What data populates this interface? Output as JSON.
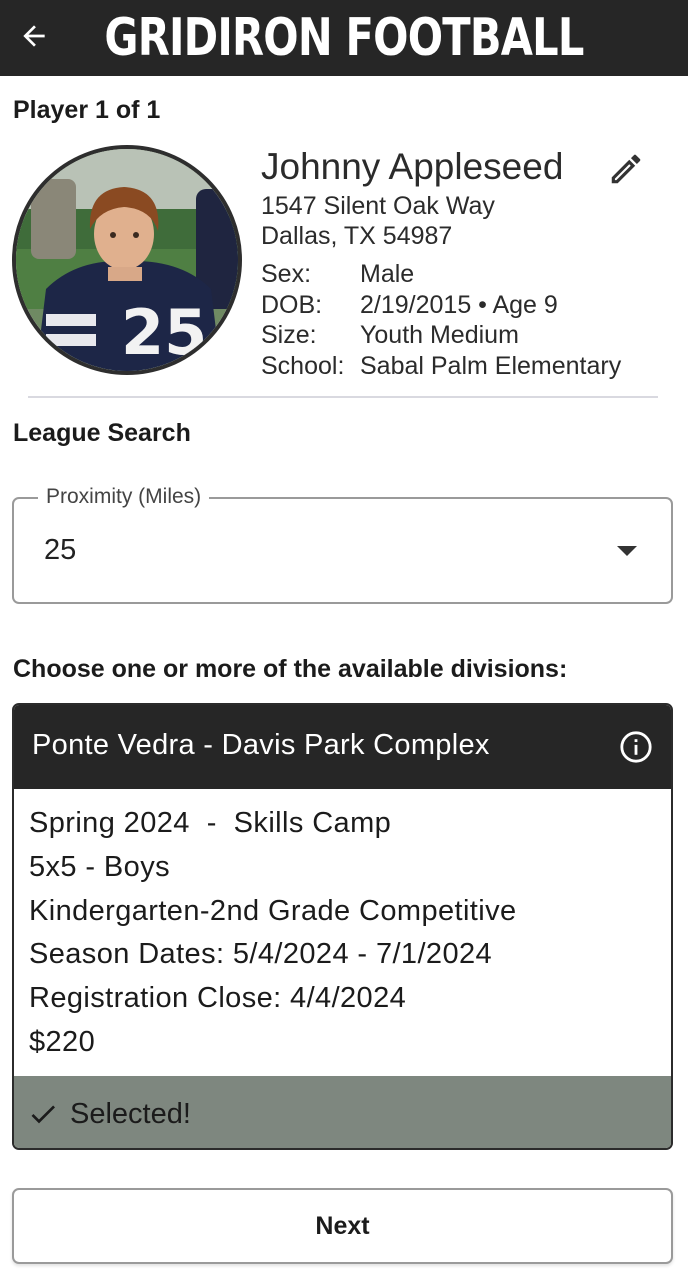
{
  "header": {
    "title": "GRIDIRON FOOTBALL",
    "back_icon": "arrow-left-icon"
  },
  "player_count": "Player 1 of 1",
  "player": {
    "name": "Johnny Appleseed",
    "edit_icon": "pencil-icon",
    "address_line1": "1547 Silent Oak Way",
    "address_line2": "Dallas, TX 54987",
    "details": [
      {
        "label": "Sex:",
        "value": "Male"
      },
      {
        "label": "DOB:",
        "value": "2/19/2015 • Age 9"
      },
      {
        "label": "Size:",
        "value": "Youth Medium"
      },
      {
        "label": "School:",
        "value": "Sabal Palm Elementary"
      }
    ]
  },
  "league_search": {
    "heading": "League Search",
    "proximity": {
      "label": "Proximity (Miles)",
      "value": "25"
    }
  },
  "divisions": {
    "heading": "Choose one or more of the available divisions:",
    "cards": [
      {
        "title": "Ponte Vedra - Davis Park Complex",
        "info_icon": "info-icon",
        "lines": [
          "Spring 2024  -  Skills Camp",
          "5x5 - Boys",
          "Kindergarten-2nd Grade Competitive",
          "Season Dates: 5/4/2024 - 7/1/2024",
          "Registration Close: 4/4/2024",
          "$220"
        ],
        "status": "Selected!",
        "status_icon": "check-icon"
      }
    ]
  },
  "next_label": "Next",
  "colors": {
    "header_bg": "#262626",
    "selected_bg": "#7e877f"
  }
}
